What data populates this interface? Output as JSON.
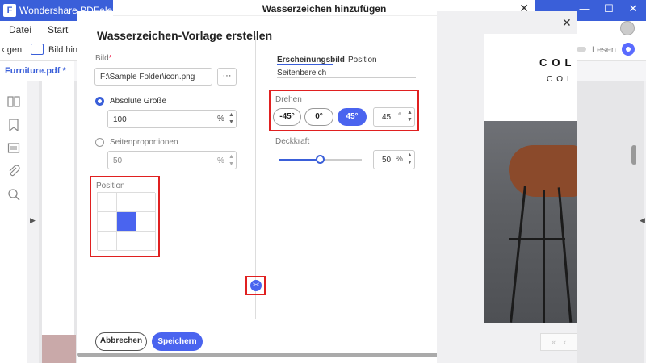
{
  "app": {
    "title": "Wondershare PDFelement",
    "logo_letter": "F",
    "window_controls": {
      "minimize": "—",
      "maximize": "☐",
      "close": "✕"
    }
  },
  "menu": {
    "items": [
      "Datei",
      "Start"
    ]
  },
  "toolbar": {
    "left_cut": "‹ gen",
    "add_image_label": "Bild hinzu",
    "read_label": "Lesen"
  },
  "file_tab": {
    "label": "Furniture.pdf *"
  },
  "modal": {
    "title": "Wasserzeichen hinzufügen",
    "close": "✕",
    "heading": "Wasserzeichen-Vorlage erstellen",
    "image": {
      "label": "Bild",
      "required_mark": "*",
      "path": "F:\\Sample Folder\\icon.png",
      "browse": "···"
    },
    "size": {
      "absolute_label": "Absolute Größe",
      "absolute_value": "100",
      "absolute_unit": "%",
      "relative_label": "Seitenproportionen",
      "relative_value": "50",
      "relative_unit": "%",
      "selected": "absolute"
    },
    "position": {
      "label": "Position",
      "selected_cell": 4
    },
    "tabs": {
      "appearance": "Erscheinungsbild",
      "position": "Position",
      "page_range": "Seitenbereich",
      "active": "appearance"
    },
    "rotate": {
      "label": "Drehen",
      "options": [
        "-45°",
        "0°",
        "45°"
      ],
      "selected": "45°",
      "value": "45",
      "unit": "°"
    },
    "opacity": {
      "label": "Deckkraft",
      "value": "50",
      "unit": "%",
      "level_percent": 50
    },
    "collapse_icon": "><",
    "buttons": {
      "cancel": "Abbrechen",
      "save": "Speichern"
    }
  },
  "preview": {
    "close": "✕",
    "heading_line1": "COL",
    "heading_line2": "COL",
    "nav_prev": "«",
    "nav_next": "‹"
  },
  "colors": {
    "accent": "#4a64ef",
    "titlebar": "#3a5fd9",
    "highlight": "#e02020"
  }
}
